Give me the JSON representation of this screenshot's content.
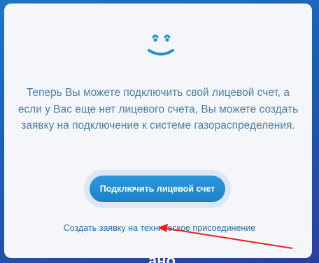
{
  "content": {
    "message": "Теперь Вы можете подключить свой лицевой счет, а если у Вас еще нет лицевого счета, Вы можете создать заявку на подключение к системе газораспределения."
  },
  "actions": {
    "connect_button": "Подключить лицевой счет",
    "create_request_link": "Создать заявку на техническое присоединение"
  },
  "footer": {
    "logo_text": "ано"
  },
  "icons": {
    "smiley": "smiley-face-icon",
    "annotation": "red-arrow-annotation"
  },
  "colors": {
    "background": "#1a5fb3",
    "card": "#f4f6fa",
    "text": "#4f7fa8",
    "button": "#1d80c6",
    "link": "#2f6a9e",
    "arrow": "#e8201c"
  }
}
